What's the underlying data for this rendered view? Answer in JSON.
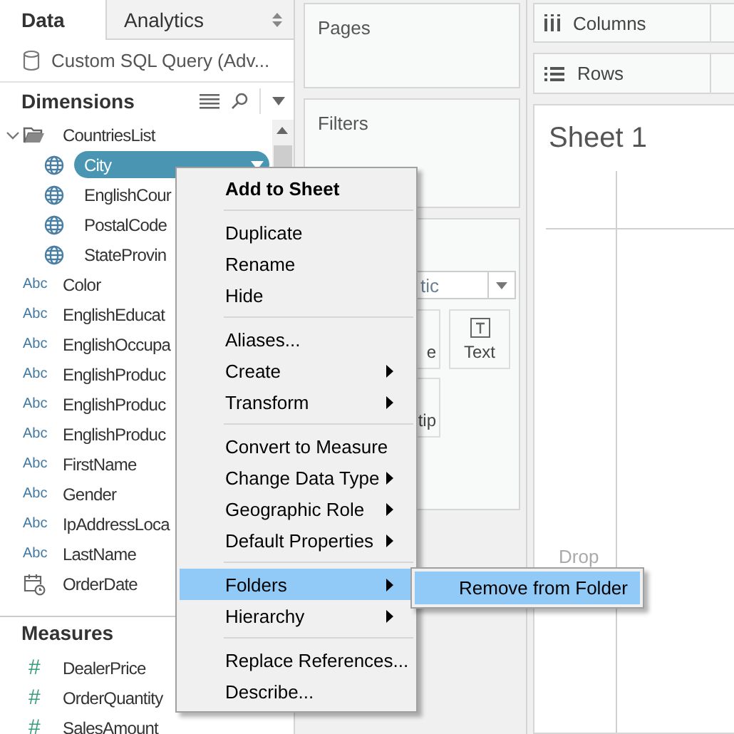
{
  "sidebar": {
    "tabs": [
      {
        "label": "Data",
        "selected": true
      },
      {
        "label": "Analytics",
        "selected": false
      }
    ],
    "data_source": "Custom SQL Query (Adv...",
    "dimensions": {
      "title": "Dimensions",
      "items": [
        {
          "label": "CountriesList",
          "kind": "folder",
          "expanded": true,
          "selected": false,
          "children": [
            {
              "label": "City",
              "kind": "geo",
              "selected": true
            },
            {
              "label": "EnglishCour",
              "kind": "geo",
              "selected": false
            },
            {
              "label": "PostalCode",
              "kind": "geo",
              "selected": false
            },
            {
              "label": "StateProvin",
              "kind": "geo",
              "selected": false
            }
          ]
        },
        {
          "label": "Color",
          "kind": "string",
          "icon_text": "Abc",
          "selected": false
        },
        {
          "label": "EnglishEducat",
          "kind": "string",
          "icon_text": "Abc",
          "selected": false
        },
        {
          "label": "EnglishOccupa",
          "kind": "string",
          "icon_text": "Abc",
          "selected": false
        },
        {
          "label": "EnglishProduc",
          "kind": "string",
          "icon_text": "Abc",
          "selected": false
        },
        {
          "label": "EnglishProduc",
          "kind": "string",
          "icon_text": "Abc",
          "selected": false
        },
        {
          "label": "EnglishProduc",
          "kind": "string",
          "icon_text": "Abc",
          "selected": false
        },
        {
          "label": "FirstName",
          "kind": "string",
          "icon_text": "Abc",
          "selected": false
        },
        {
          "label": "Gender",
          "kind": "string",
          "icon_text": "Abc",
          "selected": false
        },
        {
          "label": "IpAddressLoca",
          "kind": "string",
          "icon_text": "Abc",
          "selected": false
        },
        {
          "label": "LastName",
          "kind": "string",
          "icon_text": "Abc",
          "selected": false
        },
        {
          "label": "OrderDate",
          "kind": "date",
          "selected": false
        }
      ]
    },
    "measures": {
      "title": "Measures",
      "items": [
        {
          "label": "DealerPrice",
          "kind": "number",
          "icon_text": "#",
          "selected": false
        },
        {
          "label": "OrderQuantity",
          "kind": "number",
          "icon_text": "#",
          "selected": false
        },
        {
          "label": "SalesAmount",
          "kind": "number",
          "icon_text": "#",
          "selected": false
        }
      ]
    }
  },
  "pages_shelf": {
    "title": "Pages"
  },
  "filters_shelf": {
    "title": "Filters"
  },
  "marks": {
    "mark_type": "tic",
    "buttons": [
      {
        "label": "e",
        "kind": "size"
      },
      {
        "label": "Text",
        "kind": "text"
      },
      {
        "label": "tip",
        "kind": "tooltip"
      }
    ]
  },
  "columns_shelf": {
    "label": "Columns"
  },
  "rows_shelf": {
    "label": "Rows"
  },
  "sheet": {
    "title": "Sheet 1",
    "drop_hint": "Drop"
  },
  "context_menu": {
    "items": [
      {
        "label": "Add to Sheet",
        "kind": "bold",
        "selected": false
      },
      {
        "kind": "separator"
      },
      {
        "label": "Duplicate",
        "kind": "plain",
        "selected": false
      },
      {
        "label": "Rename",
        "kind": "plain",
        "selected": false
      },
      {
        "label": "Hide",
        "kind": "plain",
        "selected": false
      },
      {
        "kind": "separator"
      },
      {
        "label": "Aliases...",
        "kind": "plain",
        "selected": false
      },
      {
        "label": "Create",
        "kind": "submenu",
        "selected": false
      },
      {
        "label": "Transform",
        "kind": "submenu",
        "selected": false
      },
      {
        "kind": "separator"
      },
      {
        "label": "Convert to Measure",
        "kind": "plain",
        "selected": false
      },
      {
        "label": "Change Data Type",
        "kind": "submenu",
        "selected": false
      },
      {
        "label": "Geographic Role",
        "kind": "submenu",
        "selected": false
      },
      {
        "label": "Default Properties",
        "kind": "submenu",
        "selected": false
      },
      {
        "kind": "separator"
      },
      {
        "label": "Folders",
        "kind": "submenu",
        "selected": true
      },
      {
        "label": "Hierarchy",
        "kind": "submenu",
        "selected": false
      },
      {
        "kind": "separator"
      },
      {
        "label": "Replace References...",
        "kind": "plain",
        "selected": false
      },
      {
        "label": "Describe...",
        "kind": "plain",
        "selected": false
      }
    ]
  },
  "submenu": {
    "items": [
      {
        "label": "Remove from Folder",
        "selected": true
      }
    ]
  }
}
